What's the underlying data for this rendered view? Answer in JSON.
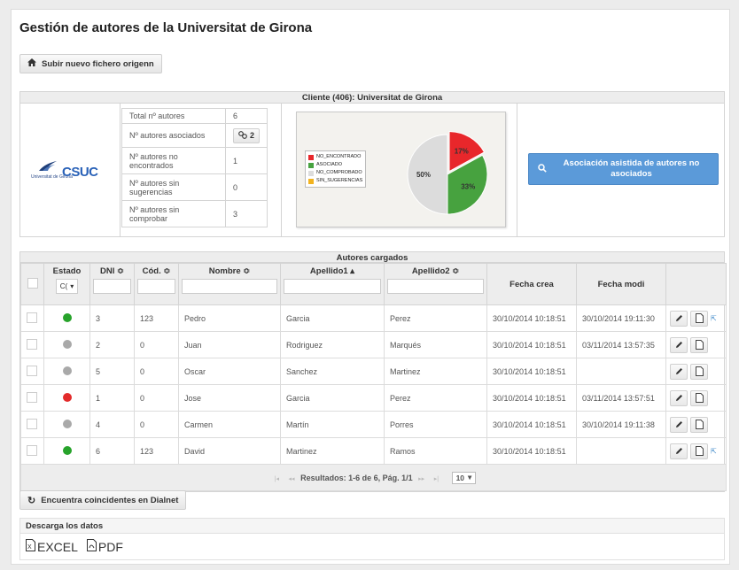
{
  "page": {
    "title": "Gestión de autores de la Universitat de Girona",
    "upload_button": "Subir nuevo fichero origenn",
    "dialnet_button": "Encuentra coincidentes en Dialnet"
  },
  "client": {
    "heading": "Cliente (406): Universitat de Girona",
    "logo_small_text": "Universitat de Girona",
    "logo_text": "CSUC",
    "stats": [
      {
        "label": "Total nº autores",
        "value": "6"
      },
      {
        "label": "Nº autores asociados",
        "value": "2"
      },
      {
        "label": "Nº autores no encontrados",
        "value": "1"
      },
      {
        "label": "Nº autores sin sugerencias",
        "value": "0"
      },
      {
        "label": "Nº autores sin comprobar",
        "value": "3"
      }
    ],
    "assist_button": "Asociación asistida de autores no asociados"
  },
  "chart_data": {
    "type": "pie",
    "slices": [
      {
        "label": "NO_ENCONTRADO",
        "value": 17,
        "color": "#e8272b",
        "display": "17%"
      },
      {
        "label": "ASOCIADO",
        "value": 33,
        "color": "#47a23f",
        "display": "33%"
      },
      {
        "label": "NO_COMPROBADO",
        "value": 50,
        "color": "#dcdcdc",
        "display": "50%"
      },
      {
        "label": "SIN_SUGERENCIAS",
        "value": 0,
        "color": "#f2b31f",
        "display": ""
      }
    ],
    "legend_placement": "left"
  },
  "authors": {
    "heading": "Autores cargados",
    "columns": {
      "estado": "Estado",
      "dni": "DNI ≎",
      "cod": "Cód. ≎",
      "nombre": "Nombre ≎",
      "apellido1": "Apellido1 ▴",
      "apellido2": "Apellido2 ≎",
      "fecha_crea": "Fecha crea",
      "fecha_modi": "Fecha modi"
    },
    "estado_filter": "C(",
    "rows": [
      {
        "status": "#27a32b",
        "dni": "3",
        "cod": "123",
        "nombre": "Pedro",
        "apellido1": "Garcia",
        "apellido2": "Perez",
        "fecha_crea": "30/10/2014 10:18:51",
        "fecha_modi": "30/10/2014 19:11:30",
        "ext": true
      },
      {
        "status": "#a9a9a9",
        "dni": "2",
        "cod": "0",
        "nombre": "Juan",
        "apellido1": "Rodriguez",
        "apellido2": "Marqués",
        "fecha_crea": "30/10/2014 10:18:51",
        "fecha_modi": "03/11/2014 13:57:35",
        "ext": false
      },
      {
        "status": "#a9a9a9",
        "dni": "5",
        "cod": "0",
        "nombre": "Oscar",
        "apellido1": "Sanchez",
        "apellido2": "Martinez",
        "fecha_crea": "30/10/2014 10:18:51",
        "fecha_modi": "",
        "ext": false
      },
      {
        "status": "#e32b2b",
        "dni": "1",
        "cod": "0",
        "nombre": "Jose",
        "apellido1": "Garcia",
        "apellido2": "Perez",
        "fecha_crea": "30/10/2014 10:18:51",
        "fecha_modi": "03/11/2014 13:57:51",
        "ext": false
      },
      {
        "status": "#a9a9a9",
        "dni": "4",
        "cod": "0",
        "nombre": "Carmen",
        "apellido1": "Martín",
        "apellido2": "Porres",
        "fecha_crea": "30/10/2014 10:18:51",
        "fecha_modi": "30/10/2014 19:11:38",
        "ext": false
      },
      {
        "status": "#27a32b",
        "dni": "6",
        "cod": "123",
        "nombre": "David",
        "apellido1": "Martinez",
        "apellido2": "Ramos",
        "fecha_crea": "30/10/2014 10:18:51",
        "fecha_modi": "",
        "ext": true
      }
    ],
    "pager": {
      "results": "Resultados: 1-6 de 6, Pág. 1/1",
      "page_size": "10"
    }
  },
  "download": {
    "heading": "Descarga los datos",
    "excel": "EXCEL",
    "pdf": "PDF"
  }
}
